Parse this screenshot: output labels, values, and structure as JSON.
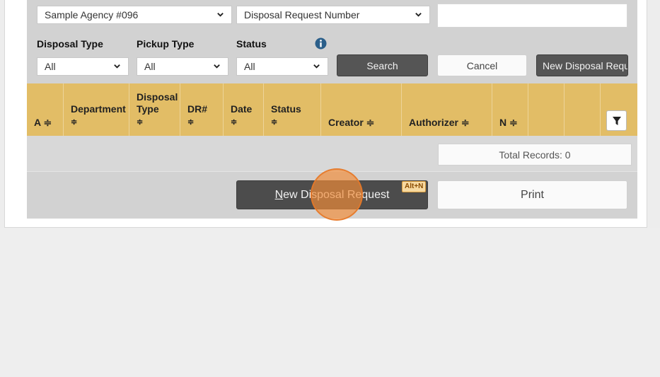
{
  "filters": {
    "agency_value": "Sample Agency #096",
    "search_field_value": "Disposal Request Number",
    "search_text_value": "",
    "disposal_type_label": "Disposal Type",
    "disposal_type_value": "All",
    "pickup_type_label": "Pickup Type",
    "pickup_type_value": "All",
    "status_label": "Status",
    "status_value": "All",
    "info_icon": "info-circle-icon"
  },
  "buttons": {
    "search": "Search",
    "cancel": "Cancel",
    "new_request_top": "New Disposal Reque",
    "new_request_bottom_prefix": "N",
    "new_request_bottom_rest": "ew Disposal Request",
    "new_request_shortcut": "Alt+N",
    "print": "Print"
  },
  "table": {
    "columns": [
      {
        "line1": "",
        "line2": "",
        "line3": "A ≑"
      },
      {
        "line1": "",
        "line2": "Department",
        "line3": "≑"
      },
      {
        "line1": "Disposal",
        "line2": "Type",
        "line3": "≑"
      },
      {
        "line1": "",
        "line2": "DR#",
        "line3": "≑"
      },
      {
        "line1": "",
        "line2": "Date",
        "line3": "≑"
      },
      {
        "line1": "",
        "line2": "Status",
        "line3": "≑"
      },
      {
        "line1": "",
        "line2": "",
        "line3": "Creator ≑"
      },
      {
        "line1": "",
        "line2": "",
        "line3": "Authorizer ≑"
      },
      {
        "line1": "",
        "line2": "",
        "line3": "N ≑"
      },
      {
        "line1": "",
        "line2": "",
        "line3": ""
      },
      {
        "line1": "",
        "line2": "",
        "line3": ""
      }
    ],
    "filter_icon": "filter-funnel-icon",
    "total_records": "Total Records: 0"
  },
  "colors": {
    "header_bg": "#e2bd66",
    "panel_bg": "#d2d2d2",
    "dark_button": "#555555",
    "cursor_highlight": "#f28c38"
  }
}
